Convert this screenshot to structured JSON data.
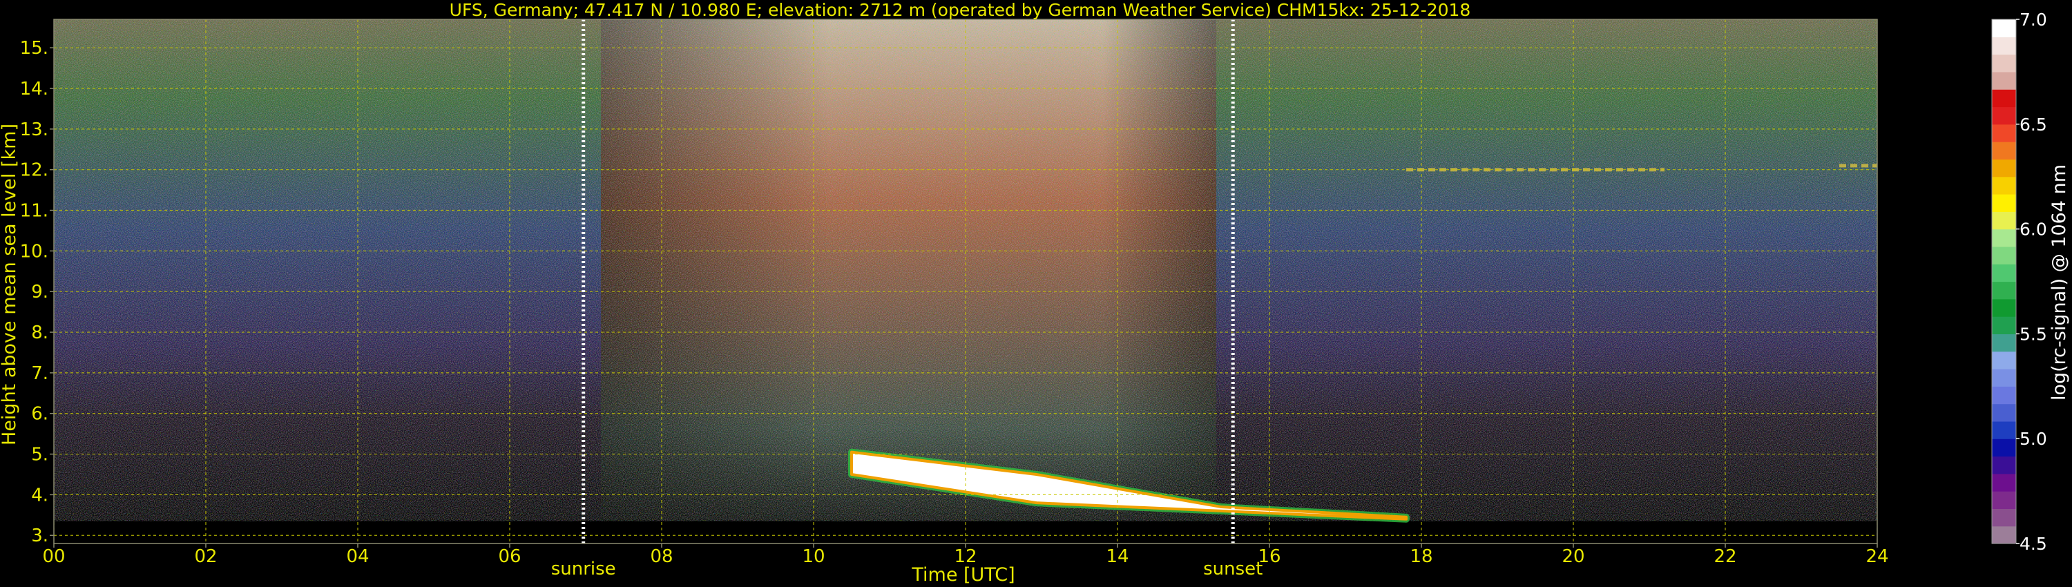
{
  "chart_data": {
    "type": "heatmap",
    "title": "UFS, Germany; 47.417 N / 10.980 E; elevation: 2712 m  (operated by German Weather Service)    CHM15kx: 25-12-2018",
    "xlabel": "Time [UTC]",
    "ylabel": "Height above mean sea level [km]",
    "xlim": [
      0,
      24
    ],
    "ylim": [
      2.8,
      15.7
    ],
    "x_ticks": [
      {
        "value": 0,
        "label": "00"
      },
      {
        "value": 2,
        "label": "02"
      },
      {
        "value": 4,
        "label": "04"
      },
      {
        "value": 6,
        "label": "06"
      },
      {
        "value": 8,
        "label": "08"
      },
      {
        "value": 10,
        "label": "10"
      },
      {
        "value": 12,
        "label": "12"
      },
      {
        "value": 14,
        "label": "14"
      },
      {
        "value": 16,
        "label": "16"
      },
      {
        "value": 18,
        "label": "18"
      },
      {
        "value": 20,
        "label": "20"
      },
      {
        "value": 22,
        "label": "22"
      },
      {
        "value": 24,
        "label": "24"
      }
    ],
    "y_ticks": [
      {
        "value": 3,
        "label": "3."
      },
      {
        "value": 4,
        "label": "4."
      },
      {
        "value": 5,
        "label": "5."
      },
      {
        "value": 6,
        "label": "6."
      },
      {
        "value": 7,
        "label": "7."
      },
      {
        "value": 8,
        "label": "8."
      },
      {
        "value": 9,
        "label": "9."
      },
      {
        "value": 10,
        "label": "10."
      },
      {
        "value": 11,
        "label": "11."
      },
      {
        "value": 12,
        "label": "12."
      },
      {
        "value": 13,
        "label": "13."
      },
      {
        "value": 14,
        "label": "14."
      },
      {
        "value": 15,
        "label": "15."
      }
    ],
    "grid": true,
    "markers": [
      {
        "name": "sunrise",
        "x": 6.97
      },
      {
        "name": "sunset",
        "x": 15.52
      }
    ],
    "cloud_layer": {
      "start_time": 10.5,
      "end_time": 17.8,
      "top_height": [
        5.05,
        4.5,
        3.7,
        3.45
      ],
      "base_height": [
        4.5,
        3.8,
        3.6,
        3.4
      ]
    },
    "high_clouds": [
      {
        "time_start": 17.8,
        "time_end": 21.2,
        "height": 12.0
      },
      {
        "time_start": 23.5,
        "time_end": 24.0,
        "height": 12.1
      }
    ],
    "colorbar": {
      "label": "log(rc-signal) @ 1064 nm",
      "range": [
        4.5,
        7.0
      ],
      "ticks": [
        {
          "value": 4.5,
          "label": "4.5"
        },
        {
          "value": 5.0,
          "label": "5.0"
        },
        {
          "value": 5.5,
          "label": "5.5"
        },
        {
          "value": 6.0,
          "label": "6.0"
        },
        {
          "value": 6.5,
          "label": "6.5"
        },
        {
          "value": 7.0,
          "label": "7.0"
        }
      ],
      "colors": [
        "#9c7e99",
        "#8a4f8e",
        "#7e2b8c",
        "#6d0f8e",
        "#3a0f96",
        "#0a10a8",
        "#1e3ec0",
        "#4a5fd0",
        "#6a78e0",
        "#7a90e4",
        "#8eaaea",
        "#40a090",
        "#20a050",
        "#109a30",
        "#30b050",
        "#50c870",
        "#80d880",
        "#a8e890",
        "#e8f050",
        "#fff000",
        "#f8d000",
        "#f0a800",
        "#f07820",
        "#f04828",
        "#e02020",
        "#d81010",
        "#d8a8a0",
        "#e8c8c0",
        "#f4e4e0",
        "#ffffff"
      ]
    }
  }
}
